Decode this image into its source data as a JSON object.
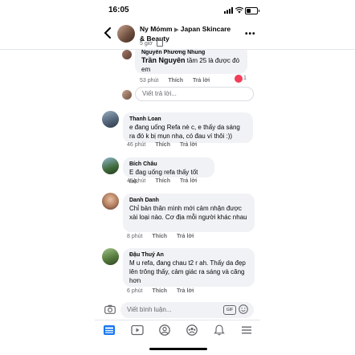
{
  "status_bar": {
    "time": "16:05"
  },
  "header": {
    "author": "Ny Mómm",
    "separator": "▶",
    "group": "Japan Skincare & Beauty",
    "time": "5 giờ",
    "privacy_icon": "group-icon",
    "more": "•••"
  },
  "comments": [
    {
      "name": "Nguyễn Phương Nhung",
      "tag": "Trần Nguyên",
      "text": " tầm 25 là được đó em",
      "time": "53 phút",
      "like": "Thích",
      "reply": "Trả lời",
      "reactions": "1",
      "reaction_color": "#f33e58"
    },
    {
      "name": "Thanh Loan",
      "text": "e đang uống Refa nè c, e thấy da sáng ra đó k bị mụn nha, có đau ví thôi :))",
      "time": "46 phút",
      "like": "Thích",
      "reply": "Trả lời"
    },
    {
      "name": "Bích Châu",
      "text": "E đag uống refa thấy tốt nè.",
      "time": "45 phút",
      "like": "Thích",
      "reply": "Trả lời"
    },
    {
      "name": "Danh Danh",
      "text": "Chỉ bản thân mình mới cảm nhận được xài loại nào. Cơ địa mỗi người khác nhau",
      "time": "8 phút",
      "like": "Thích",
      "reply": "Trả lời"
    },
    {
      "name": "Đậu Thuý An",
      "text": "M u refa, đang chau t2 r ah. Thấy da đẹp lên trông thấy, cảm giác ra sáng và căng hơn",
      "time": "6 phút",
      "like": "Thích",
      "reply": "Trả lời"
    }
  ],
  "reply_box": {
    "placeholder": "Viết trả lời..."
  },
  "comment_box": {
    "placeholder": "Viết bình luận...",
    "gif": "GIF"
  },
  "tab_bar": {
    "tabs": [
      "news-feed-icon",
      "watch-icon",
      "profile-icon",
      "groups-icon",
      "notifications-icon",
      "menu-icon"
    ],
    "accent": "#1877f2"
  }
}
